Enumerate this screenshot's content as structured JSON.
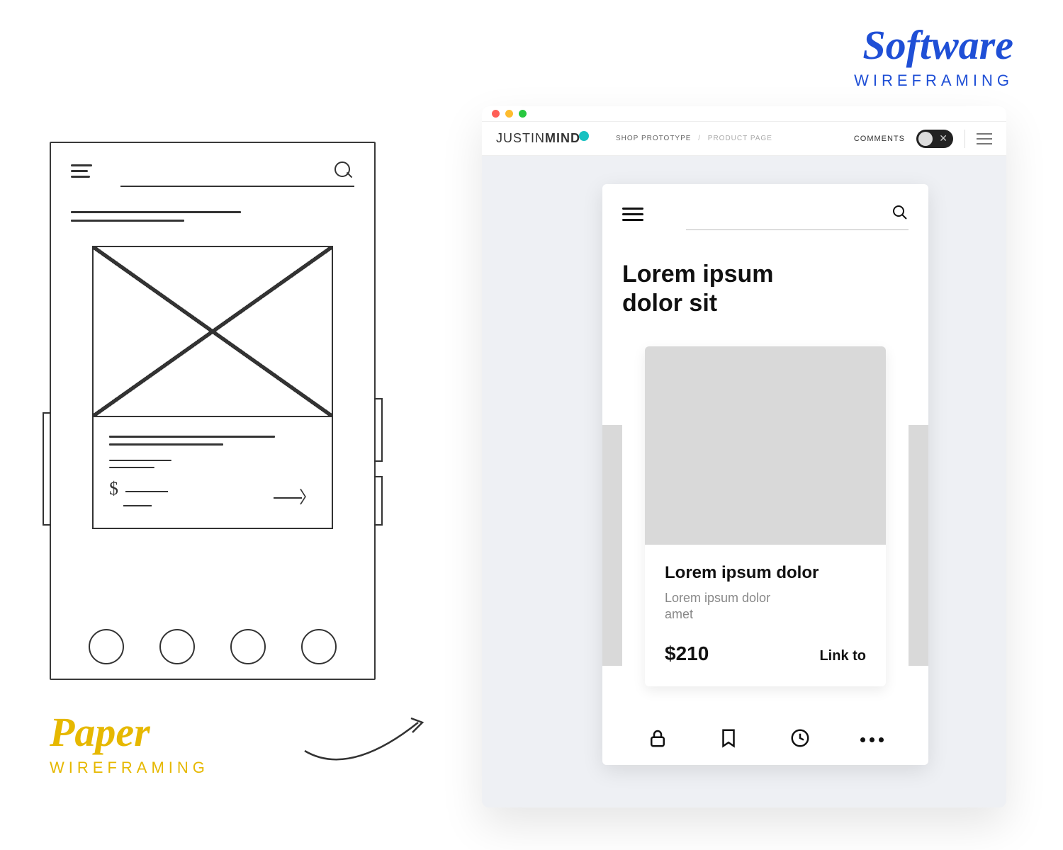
{
  "labels": {
    "paper_big": "Paper",
    "paper_small": "WIREFRAMING",
    "software_big": "Software",
    "software_small": "WIREFRAMING"
  },
  "app": {
    "brand_light": "JUSTIN",
    "brand_bold": "MIND",
    "breadcrumb_root": "SHOP PROTOTYPE",
    "breadcrumb_current": "PRODUCT PAGE",
    "comments_label": "COMMENTS"
  },
  "phone": {
    "title": "Lorem ipsum dolor sit",
    "card": {
      "heading": "Lorem ipsum dolor",
      "sub": "Lorem ipsum dolor amet",
      "price": "$210",
      "link": "Link to"
    }
  },
  "sketch": {
    "dollar": "$"
  }
}
